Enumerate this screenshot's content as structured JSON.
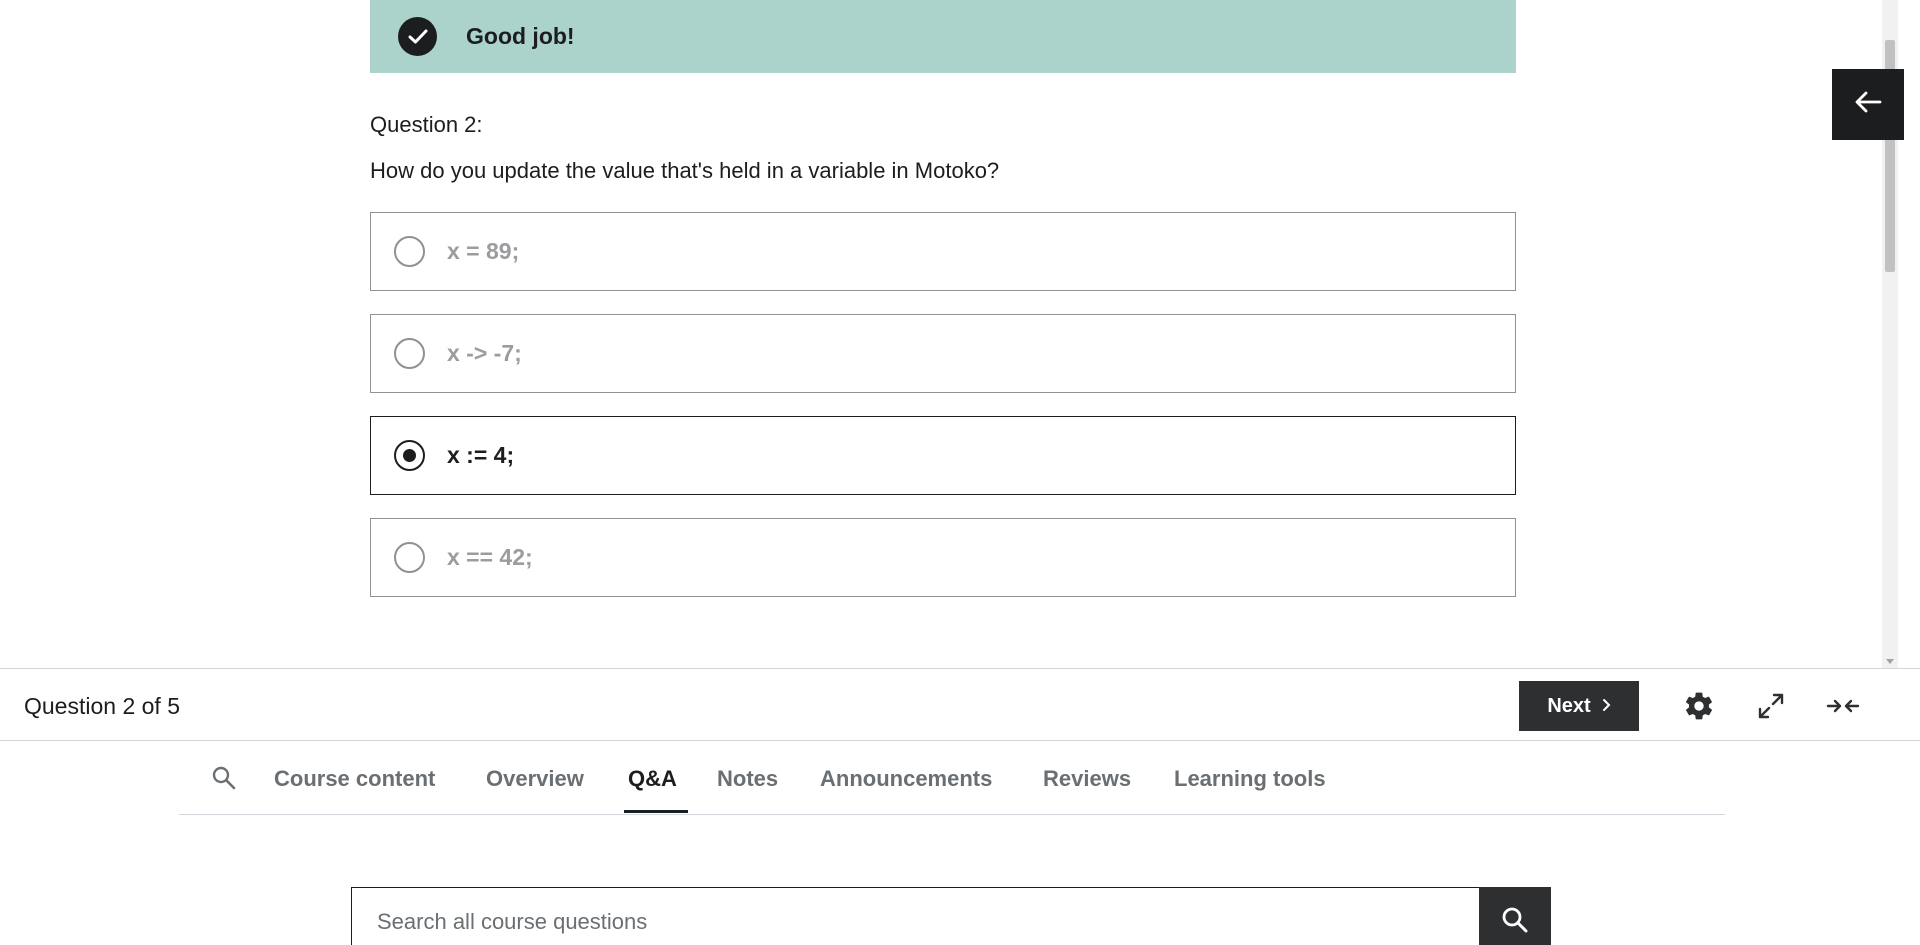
{
  "feedback": {
    "message": "Good job!",
    "icon": "check-icon"
  },
  "question": {
    "number_label": "Question 2:",
    "text": "How do you update the value that's held in a variable in Motoko?"
  },
  "options": [
    {
      "label": "x = 89;",
      "selected": false
    },
    {
      "label": "x -> -7;",
      "selected": false
    },
    {
      "label": "x := 4;",
      "selected": true
    },
    {
      "label": "x == 42;",
      "selected": false
    }
  ],
  "controls": {
    "progress": "Question 2 of 5",
    "next_label": "Next",
    "icons": [
      "gear-icon",
      "expand-icon",
      "collapse-icon"
    ]
  },
  "sidebar_toggle": {
    "icon": "arrow-left-icon"
  },
  "tabs": {
    "items": [
      "Course content",
      "Overview",
      "Q&A",
      "Notes",
      "Announcements",
      "Reviews",
      "Learning tools"
    ],
    "active": "Q&A"
  },
  "qa_search": {
    "placeholder": "Search all course questions"
  },
  "colors": {
    "feedback_bg": "#acd2cc",
    "dark": "#1c1d1f",
    "muted": "#6a6f73"
  }
}
